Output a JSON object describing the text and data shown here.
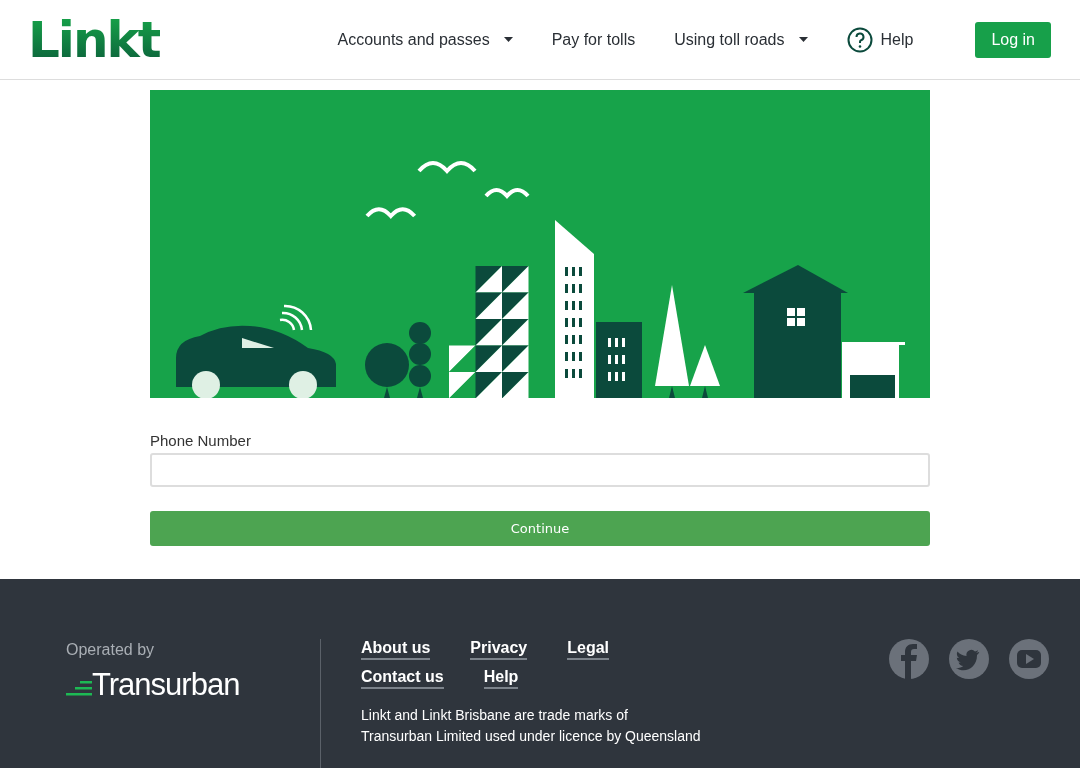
{
  "header": {
    "logo": "Linkt",
    "nav": [
      {
        "kind": "dropdown",
        "label": "Accounts and passes"
      },
      {
        "kind": "link",
        "label": "Pay for tolls"
      },
      {
        "kind": "dropdown",
        "label": "Using toll roads"
      },
      {
        "kind": "help",
        "label": "Help"
      }
    ],
    "login": "Log in"
  },
  "form": {
    "phone_label": "Phone Number",
    "continue": "Continue"
  },
  "footer": {
    "operated_by": "Operated by",
    "operator_logo": "Transurban",
    "links": [
      [
        "About us",
        "Privacy",
        "Legal"
      ],
      [
        "Contact us",
        "Help"
      ]
    ],
    "legal_lines": [
      "Linkt and Linkt Brisbane are trade marks of",
      "Transurban Limited used under licence by Queensland"
    ],
    "social": [
      {
        "kind": "facebook"
      },
      {
        "kind": "twitter"
      },
      {
        "kind": "youtube"
      }
    ]
  }
}
